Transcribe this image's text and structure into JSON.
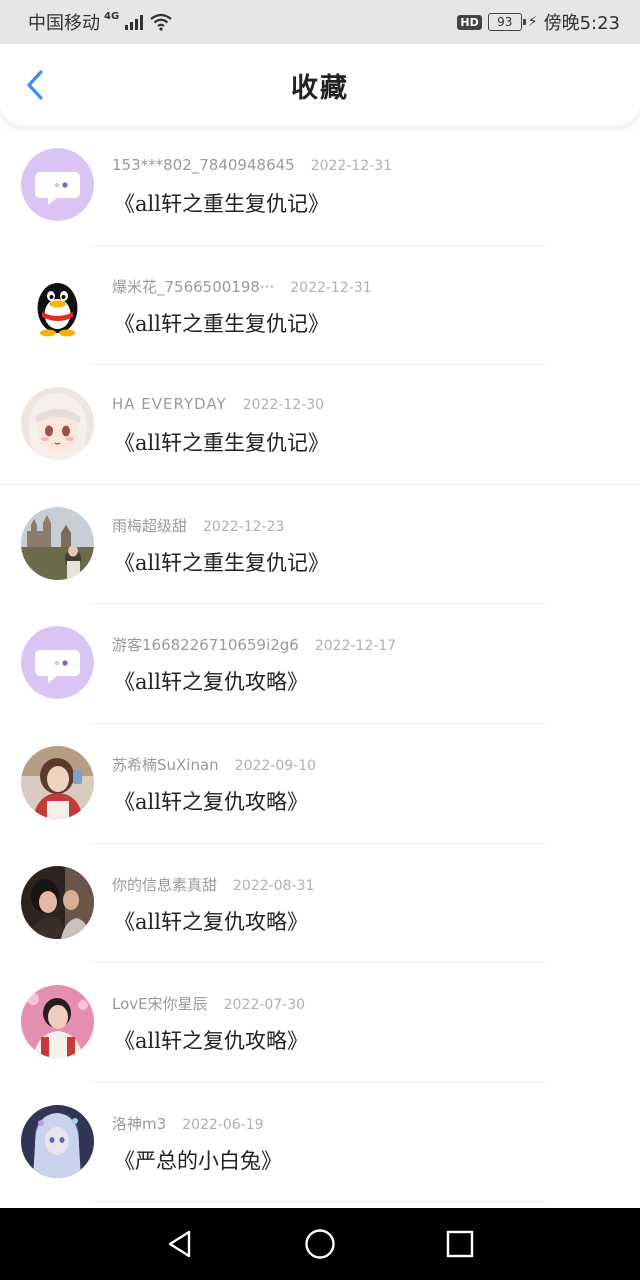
{
  "status_bar": {
    "carrier": "中国移动",
    "network": "4G",
    "battery": "93",
    "time": "傍晚5:23",
    "hd": "HD"
  },
  "header": {
    "title": "收藏",
    "accent": "#3d8ef0"
  },
  "favorites": [
    {
      "user": "153***802_7840948645",
      "date": "2022-12-31",
      "book": "《all轩之重生复仇记》",
      "avatar": "chat-bubble-avatar"
    },
    {
      "user": "爆米花_7566500198···",
      "date": "2022-12-31",
      "book": "《all轩之重生复仇记》",
      "avatar": "penguin-avatar"
    },
    {
      "user": "HA EVERYDAY",
      "date": "2022-12-30",
      "book": "《all轩之重生复仇记》",
      "avatar": "anime-girl-avatar"
    },
    {
      "user": "雨梅超级甜",
      "date": "2022-12-23",
      "book": "《all轩之重生复仇记》",
      "avatar": "castle-photo-avatar"
    },
    {
      "user": "游客1668226710659i2g6",
      "date": "2022-12-17",
      "book": "《all轩之复仇攻略》",
      "avatar": "chat-bubble-avatar"
    },
    {
      "user": "苏希楠SuXinan",
      "date": "2022-09-10",
      "book": "《all轩之复仇攻略》",
      "avatar": "girl-photo-avatar"
    },
    {
      "user": "你的信息素真甜",
      "date": "2022-08-31",
      "book": "《all轩之复仇攻略》",
      "avatar": "couple-photo-avatar"
    },
    {
      "user": "LovE宋你星辰",
      "date": "2022-07-30",
      "book": "《all轩之复仇攻略》",
      "avatar": "pink-photo-avatar"
    },
    {
      "user": "洛神m3",
      "date": "2022-06-19",
      "book": "《严总的小白兔》",
      "avatar": "fantasy-art-avatar"
    }
  ],
  "nav": {
    "back": "back-triangle-icon",
    "home": "home-circle-icon",
    "recent": "recent-square-icon"
  }
}
